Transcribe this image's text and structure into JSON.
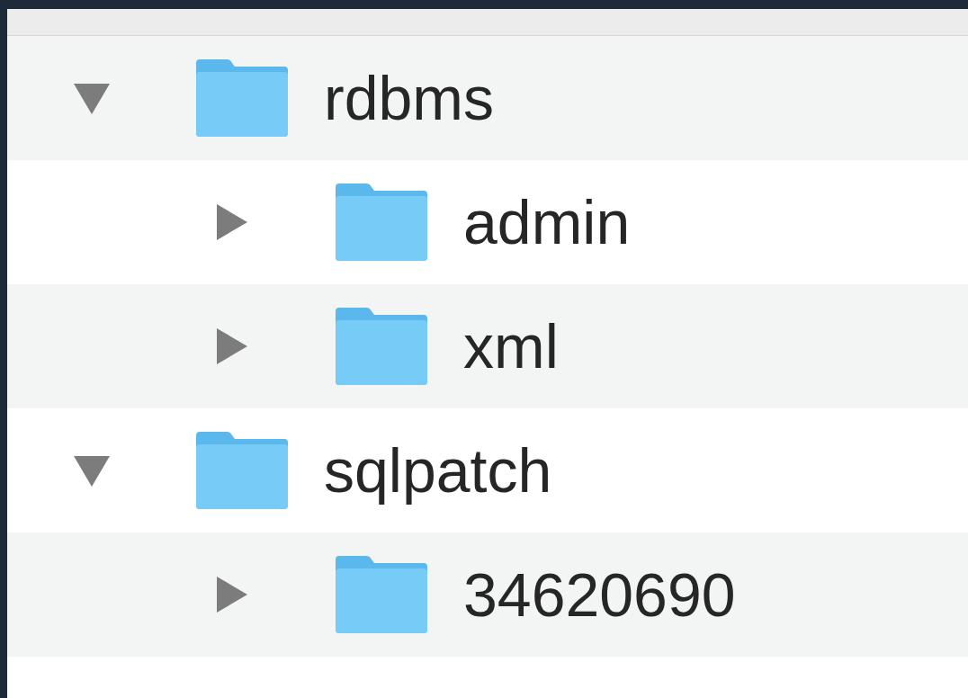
{
  "tree": [
    {
      "label": "rdbms",
      "expanded": true,
      "children": [
        {
          "label": "admin",
          "expanded": false
        },
        {
          "label": "xml",
          "expanded": false
        }
      ]
    },
    {
      "label": "sqlpatch",
      "expanded": true,
      "children": [
        {
          "label": "34620690",
          "expanded": false
        }
      ]
    }
  ]
}
